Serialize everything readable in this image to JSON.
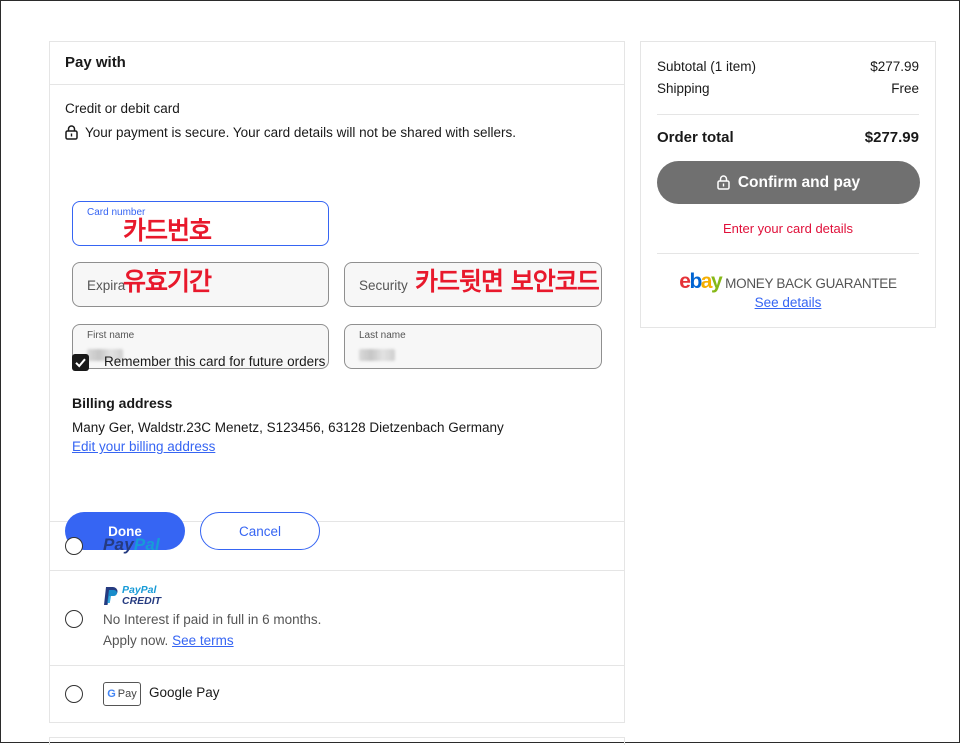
{
  "pay_with": {
    "title": "Pay with",
    "card": {
      "title": "Credit or debit card",
      "secure_text": "Your payment is secure. Your card details will not be shared with sellers.",
      "card_number_label": "Card number",
      "expiration_placeholder": "Expira",
      "security_placeholder": "Security",
      "first_name_label": "First name",
      "last_name_label": "Last name",
      "remember_label": "Remember this card for future orders",
      "remember_checked": true,
      "billing_title": "Billing address",
      "billing_address": "Many Ger, Waldstr.23C Menetz, S123456, 63128 Dietzenbach Germany",
      "edit_billing": "Edit your billing address",
      "done_label": "Done",
      "cancel_label": "Cancel"
    },
    "overlays": {
      "card_number": "카드번호",
      "expiration": "유효기간",
      "security": "카드뒷면 보안코드"
    },
    "paypal": {
      "logo_part1": "Pay",
      "logo_part2": "Pal"
    },
    "paypal_credit": {
      "logo_line1": "PayPal",
      "logo_line2": "CREDIT",
      "text1": "No Interest if paid in full in 6 months.",
      "text2_prefix": "Apply now.",
      "see_terms": "See terms"
    },
    "google_pay": {
      "badge": "G Pay",
      "label": "Google Pay"
    }
  },
  "summary": {
    "subtotal_label": "Subtotal (1 item)",
    "subtotal_value": "$277.99",
    "shipping_label": "Shipping",
    "shipping_value": "Free",
    "order_total_label": "Order total",
    "order_total_value": "$277.99",
    "confirm_label": "Confirm and pay",
    "error_text": "Enter your card details",
    "guarantee_text": "MONEY BACK GUARANTEE",
    "see_details": "See details"
  },
  "colors": {
    "accent": "#3665f3",
    "error": "#e0103a",
    "overlay_red": "#e8192c",
    "ebay_e": "#e53238",
    "ebay_b": "#0064d2",
    "ebay_a": "#f5af02",
    "ebay_y": "#86b817"
  },
  "icons": [
    "lock-icon",
    "check-icon",
    "ebay-logo",
    "google-g-icon"
  ]
}
